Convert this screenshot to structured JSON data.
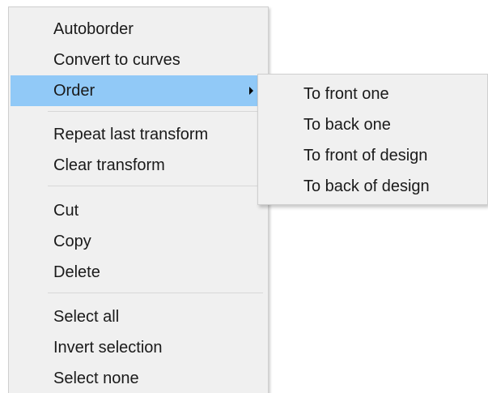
{
  "context_menu": {
    "items": [
      {
        "label": "Autoborder"
      },
      {
        "label": "Convert to curves"
      },
      {
        "label": "Order",
        "has_submenu": true,
        "highlighted": true
      },
      {
        "label": "Repeat last transform"
      },
      {
        "label": "Clear transform"
      },
      {
        "label": "Cut"
      },
      {
        "label": "Copy"
      },
      {
        "label": "Delete"
      },
      {
        "label": "Select all"
      },
      {
        "label": "Invert selection"
      },
      {
        "label": "Select none"
      }
    ],
    "highlight_color": "#91c9f7",
    "background_color": "#f0f0f0"
  },
  "order_submenu": {
    "items": [
      {
        "label": "To front one"
      },
      {
        "label": "To back one"
      },
      {
        "label": "To front of design"
      },
      {
        "label": "To back of design"
      }
    ]
  }
}
